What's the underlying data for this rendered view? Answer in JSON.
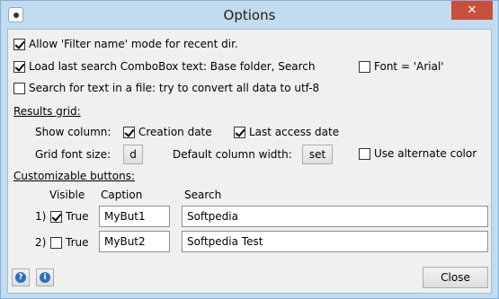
{
  "window": {
    "title": "Options",
    "close_glyph": "✕"
  },
  "options": {
    "allow_filter": {
      "label": "Allow 'Filter name' mode for recent dir.",
      "checked": true
    },
    "load_last": {
      "label": "Load last search ComboBox text: Base folder, Search",
      "checked": true
    },
    "font_arial": {
      "label": "Font = 'Arial'",
      "checked": false
    },
    "search_utf8": {
      "label": "Search for text in a file: try to convert all data to utf-8",
      "checked": false
    }
  },
  "results_grid": {
    "heading": "Results grid:",
    "show_column_label": "Show column:",
    "creation_date": {
      "label": "Creation date",
      "checked": true
    },
    "last_access_date": {
      "label": "Last access date",
      "checked": true
    },
    "grid_font_size_label": "Grid font size:",
    "grid_font_button": "d",
    "default_col_width_label": "Default column width:",
    "set_button": "set",
    "alternate_color": {
      "label": "Use alternate color",
      "checked": false
    }
  },
  "custom_buttons": {
    "heading": "Customizable buttons:",
    "headers": {
      "visible": "Visible",
      "caption": "Caption",
      "search": "Search"
    },
    "rows": [
      {
        "index": "1)",
        "visible_label": "True",
        "visible": true,
        "caption": "MyBut1",
        "search": "Softpedia"
      },
      {
        "index": "2)",
        "visible_label": "True",
        "visible": false,
        "caption": "MyBut2",
        "search": "Softpedia Test"
      }
    ]
  },
  "footer": {
    "close_label": "Close",
    "help_icon": "?",
    "info_icon": "i"
  },
  "colors": {
    "frame": "#c3dbef",
    "client": "#f0f0f0",
    "close_red": "#c7503c",
    "icon_blue": "#2e6fc0"
  }
}
